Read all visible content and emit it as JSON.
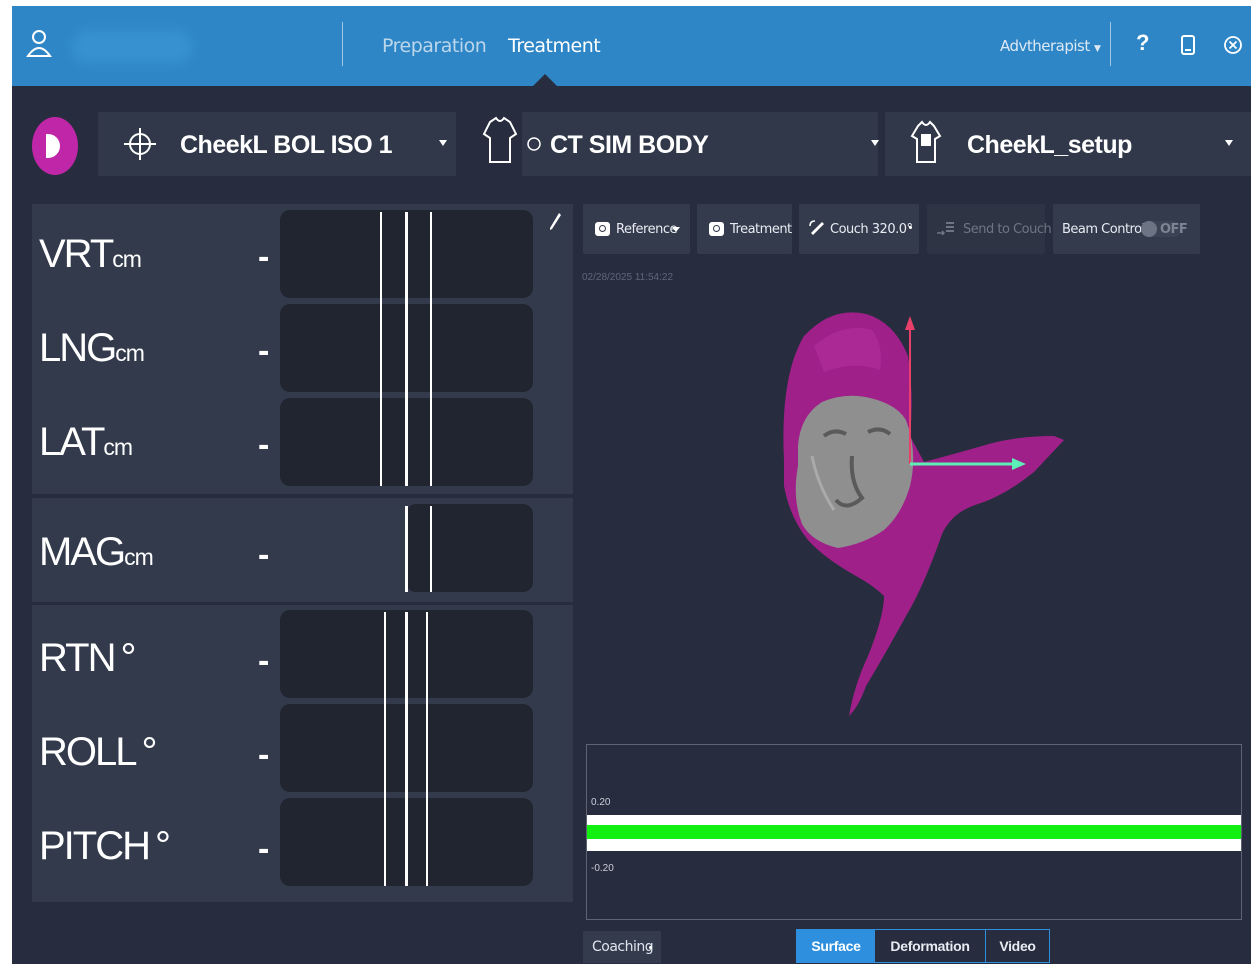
{
  "topbar": {
    "nav": {
      "preparation": "Preparation",
      "treatment": "Treatment"
    },
    "user": "Advtherapist",
    "help": "?"
  },
  "selectors": {
    "isocenter": "CheekL BOL ISO 1",
    "reference": "CT SIM BODY",
    "setup": "CheekL_setup"
  },
  "rows": [
    {
      "name": "VRT",
      "unit": "cm",
      "value": "-"
    },
    {
      "name": "LNG",
      "unit": "cm",
      "value": "-"
    },
    {
      "name": "LAT",
      "unit": "cm",
      "value": "-"
    },
    {
      "name": "MAG",
      "unit": "cm",
      "value": "-"
    },
    {
      "name": "RTN",
      "unit": "°",
      "value": "-"
    },
    {
      "name": "ROLL",
      "unit": "°",
      "value": "-"
    },
    {
      "name": "PITCH",
      "unit": "°",
      "value": "-"
    }
  ],
  "toolbar": {
    "reference": "Reference",
    "treatment": "Treatment",
    "couch": "Couch 320.0°",
    "send_to_couch": "Send to Couch",
    "beam_control": "Beam Control",
    "beam_state": "OFF"
  },
  "timestamp": "02/28/2025 11:54:22",
  "chart": {
    "upper": "0.20",
    "lower": "-0.20"
  },
  "bottom": {
    "coaching": "Coaching",
    "tabs": [
      "Surface",
      "Deformation",
      "Video"
    ],
    "active_tab": "Surface"
  },
  "colors": {
    "topbar": "#2e86c6",
    "background": "#272d3e",
    "accent_play": "#c026a8",
    "surface_model": "#a0208a",
    "chart_band": "#11f011",
    "axis_vertical": "#e8406a",
    "axis_horizontal": "#5cf0b6"
  }
}
